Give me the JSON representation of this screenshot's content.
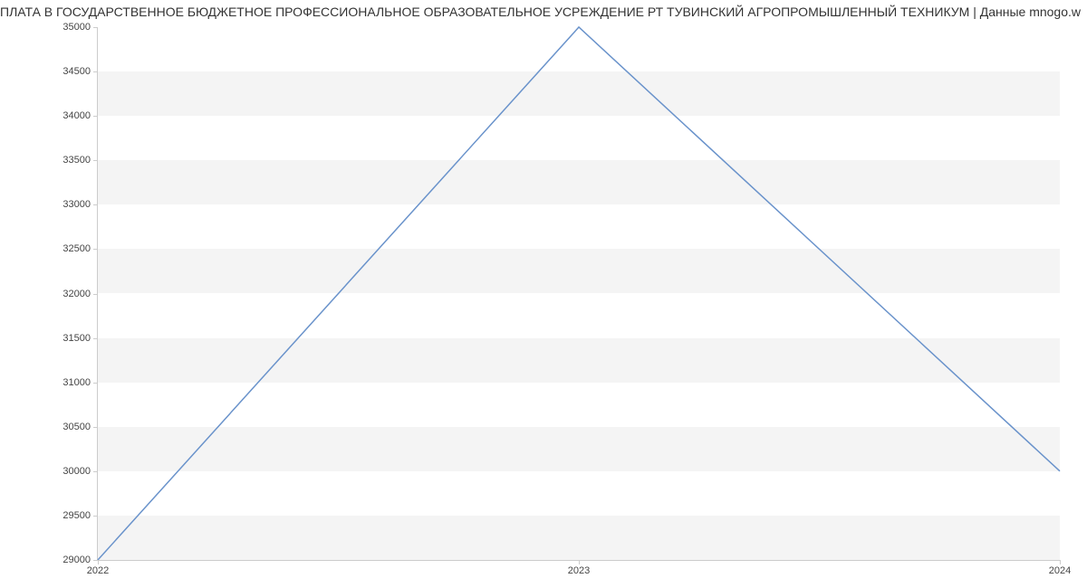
{
  "chart_data": {
    "type": "line",
    "title": "ПЛАТА В ГОСУДАРСТВЕННОЕ БЮДЖЕТНОЕ  ПРОФЕССИОНАЛЬНОЕ ОБРАЗОВАТЕЛЬНОЕ УСРЕЖДЕНИЕ РТ ТУВИНСКИЙ АГРОПРОМЫШЛЕННЫЙ ТЕХНИКУМ | Данные mnogo.w",
    "x": [
      2022,
      2023,
      2024
    ],
    "values": [
      29000,
      35000,
      30000
    ],
    "xlabel": "",
    "ylabel": "",
    "xticks": [
      2022,
      2023,
      2024
    ],
    "yticks": [
      29000,
      29500,
      30000,
      30500,
      31000,
      31500,
      32000,
      32500,
      33000,
      33500,
      34000,
      34500,
      35000
    ],
    "ylim": [
      29000,
      35000
    ],
    "xlim": [
      2022,
      2024
    ]
  }
}
